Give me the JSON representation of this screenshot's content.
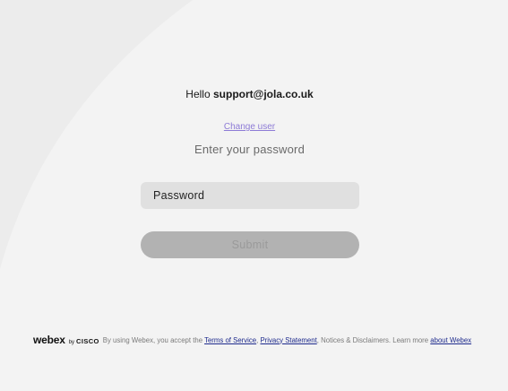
{
  "greeting": {
    "prefix": "Hello",
    "email": "support@jola.co.uk"
  },
  "change_user_label": "Change user",
  "instruction": "Enter your password",
  "password": {
    "placeholder": "Password",
    "value": ""
  },
  "submit_label": "Submit",
  "footer": {
    "logo_webex": "webex",
    "logo_by": "by",
    "logo_cisco": "CISCO",
    "text_1": "By using Webex, you accept the",
    "terms_link": "Terms of Service",
    "comma": ",",
    "privacy_link": "Privacy Statement",
    "text_2": ", Notices & Disclaimers. Learn more",
    "about_link": "about Webex"
  },
  "colors": {
    "background": "#ececec",
    "link": "#1d2a8c",
    "change_user": "#8d7bd6",
    "submit_bg": "#b2b2b2",
    "field_bg": "#e0e0e0"
  }
}
